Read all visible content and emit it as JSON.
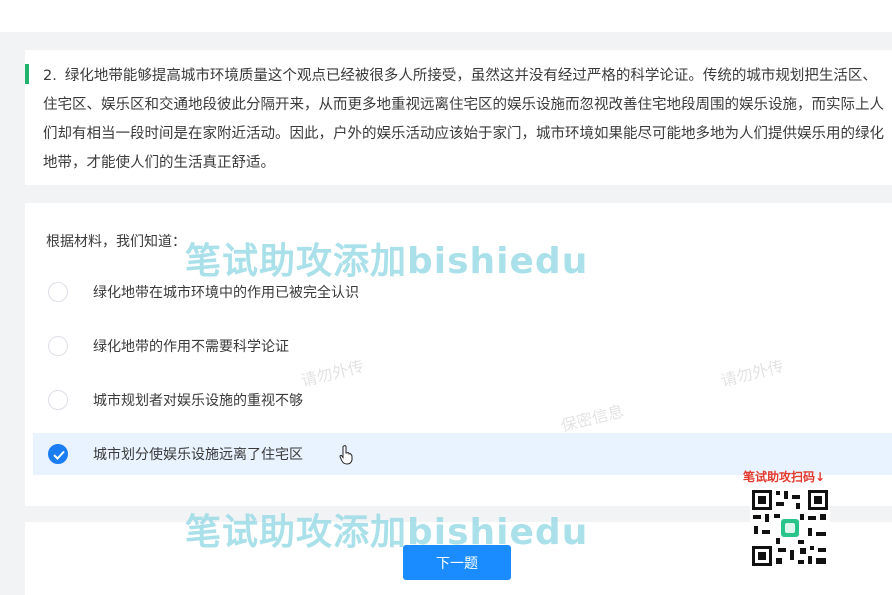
{
  "question": {
    "number": "2.",
    "text": "绿化地带能够提高城市环境质量这个观点已经被很多人所接受，虽然这并没有经过严格的科学论证。传统的城市规划把生活区、住宅区、娱乐区和交通地段彼此分隔开来，从而更多地重视远离住宅区的娱乐设施而忽视改善住宅地段周围的娱乐设施，而实际上人们却有相当一段时间是在家附近活动。因此，户外的娱乐活动应该始于家门，城市环境如果能尽可能地多地为人们提供娱乐用的绿化地带，才能使人们的生活真正舒适。"
  },
  "prompt": "根据材料，我们知道：",
  "options": [
    {
      "label": "绿化地带在城市环境中的作用已被完全认识",
      "selected": false
    },
    {
      "label": "绿化地带的作用不需要科学论证",
      "selected": false
    },
    {
      "label": "城市规划者对娱乐设施的重视不够",
      "selected": false
    },
    {
      "label": "城市划分使娱乐设施远离了住宅区",
      "selected": true
    }
  ],
  "next_button": "下一题",
  "watermark": {
    "main": "笔试助攻添加bishiedu",
    "qr_caption": "笔试助攻扫码↓",
    "faint": [
      "请勿外传",
      "保密信息"
    ]
  },
  "colors": {
    "accent": "#21b36d",
    "primary": "#1a8cff",
    "selected_bg": "#e8f3ff",
    "watermark": "#9cdbe6",
    "qr_caption": "#e23b2e"
  }
}
